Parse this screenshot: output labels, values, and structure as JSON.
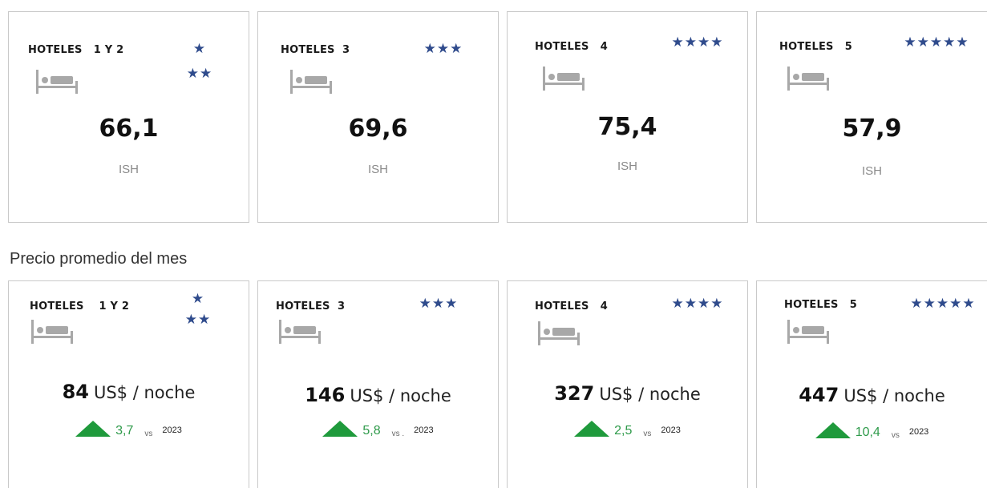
{
  "occupancy_cards": [
    {
      "title": "HOTELES   1 Y 2",
      "stars": [
        "★",
        "★★"
      ],
      "value": "66,1",
      "label": "ISH"
    },
    {
      "title": "HOTELES  3",
      "stars": [
        "★★★"
      ],
      "value": "69,6",
      "label": "ISH"
    },
    {
      "title": "HOTELES   4",
      "stars": [
        "★★★★"
      ],
      "value": "75,4",
      "label": "ISH"
    },
    {
      "title": "HOTELES   5",
      "stars": [
        "★★★★★"
      ],
      "value": "57,9",
      "label": "ISH"
    }
  ],
  "price_section": {
    "title": "Precio promedio del mes",
    "cards": [
      {
        "title": "HOTELES    1 Y 2",
        "stars": [
          "★",
          "★★"
        ],
        "price": "84",
        "unit": "US$ / noche",
        "change": "3,7",
        "vs": "vs",
        "year": "2023"
      },
      {
        "title": "HOTELES  3",
        "stars": [
          "★★★"
        ],
        "price": "146",
        "unit": "US$ / noche",
        "change": "5,8",
        "vs": "vs .",
        "year": "2023"
      },
      {
        "title": "HOTELES   4",
        "stars": [
          "★★★★"
        ],
        "price": "327",
        "unit": "US$ / noche",
        "change": "2,5",
        "vs": "vs",
        "year": "2023"
      },
      {
        "title": "HOTELES   5",
        "stars": [
          "★★★★★"
        ],
        "price": "447",
        "unit": "US$ / noche",
        "change": "10,4",
        "vs": "vs",
        "year": "2023"
      }
    ]
  },
  "colors": {
    "star": "#2f4b8c",
    "up_arrow": "#1f9a3c",
    "change_text": "#2e9a4a",
    "border": "#c9c9c9",
    "icon": "#a8a8a8"
  },
  "icons": {
    "hotel": "bed-icon",
    "trend": "triangle-up-icon"
  }
}
